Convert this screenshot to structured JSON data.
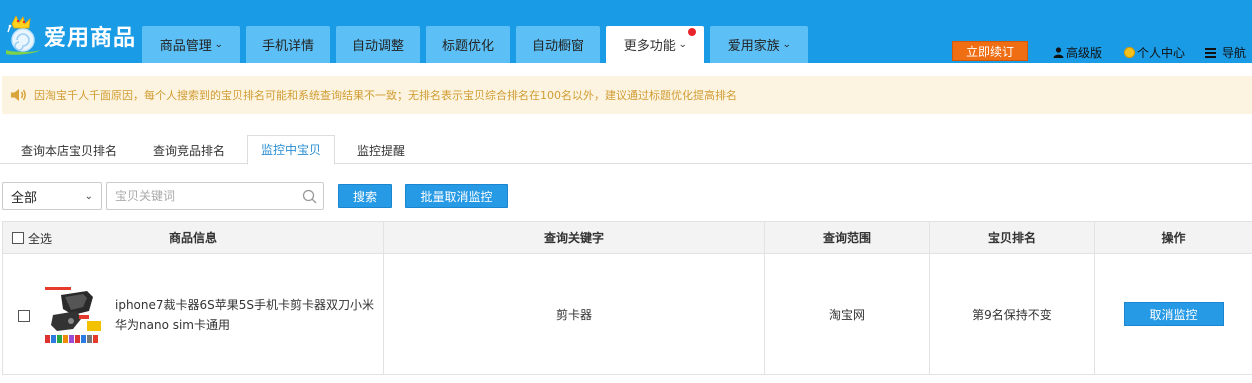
{
  "header": {
    "logo_text": "爱用商品",
    "nav": [
      {
        "label": "商品管理",
        "caret": "⌄"
      },
      {
        "label": "手机详情"
      },
      {
        "label": "自动调整"
      },
      {
        "label": "标题优化"
      },
      {
        "label": "自动橱窗"
      },
      {
        "label": "更多功能",
        "caret": "⌄"
      },
      {
        "label": "爱用家族",
        "caret": "⌄"
      }
    ],
    "renew_label": "立即续订",
    "advanced_label": "高级版",
    "personal_label": "个人中心",
    "nav_menu_label": "导航"
  },
  "notice": {
    "text": "因淘宝千人千面原因，每个人搜索到的宝贝排名可能和系统查询结果不一致；无排名表示宝贝综合排名在100名以外，建议通过标题优化提高排名"
  },
  "subtabs": [
    "查询本店宝贝排名",
    "查询竞品排名",
    "监控中宝贝",
    "监控提醒"
  ],
  "filter": {
    "select_value": "全部",
    "search_placeholder": "宝贝关键词",
    "search_label": "搜索",
    "batch_cancel_label": "批量取消监控"
  },
  "table": {
    "headers": {
      "select_all": "全选",
      "product": "商品信息",
      "keyword": "查询关键字",
      "scope": "查询范围",
      "rank": "宝贝排名",
      "action": "操作"
    },
    "rows": [
      {
        "title": "iphone7裁卡器6S苹果5S手机卡剪卡器双刀小米华为nano sim卡通用",
        "keyword": "剪卡器",
        "scope": "淘宝网",
        "rank": "第9名保持不变",
        "action_label": "取消监控"
      }
    ]
  },
  "colors": {
    "header_bg": "#1a9be6",
    "tab_bg": "#5cc0f6",
    "renew": "#ef6d13",
    "notice_bg": "#fcf4e0",
    "notice_text": "#d19c33",
    "primary_button": "#279ae6"
  }
}
